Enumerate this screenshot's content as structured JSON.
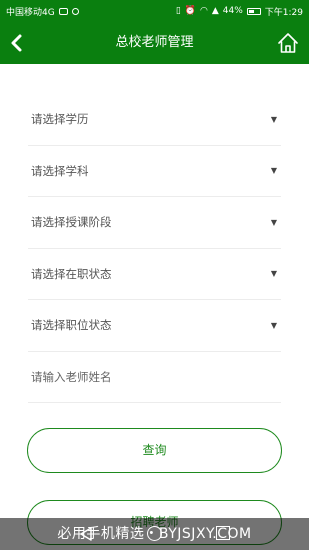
{
  "status_bar": {
    "carrier": "中国移动4G",
    "battery": "44%",
    "time": "下午1:29"
  },
  "header": {
    "title": "总校老师管理"
  },
  "filters": [
    {
      "label": "请选择学历"
    },
    {
      "label": "请选择学科"
    },
    {
      "label": "请选择授课阶段"
    },
    {
      "label": "请选择在职状态"
    },
    {
      "label": "请选择职位状态"
    }
  ],
  "name_input": {
    "placeholder": "请输入老师姓名",
    "value": ""
  },
  "buttons": {
    "query_label": "查询",
    "second_label": "招聘老师"
  },
  "watermark": {
    "text": "必用手机精选・BYJSJXY.COM"
  },
  "colors": {
    "brand_green": "#0a7f0f",
    "button_green": "#1e8a1e"
  }
}
